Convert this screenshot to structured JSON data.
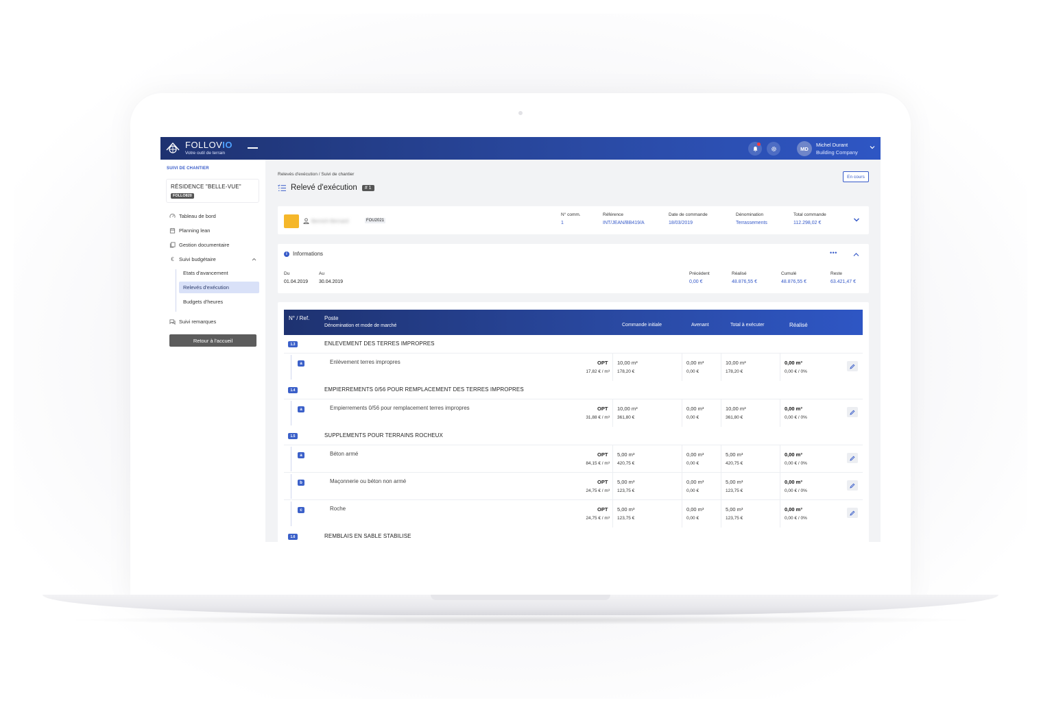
{
  "app": {
    "logo_text": "FOLLOV",
    "logo_text_accent": "IO",
    "logo_subtitle": "Votre outil de terrain",
    "user": {
      "initials": "MD",
      "name": "Michel Durant",
      "company": "Building Company"
    }
  },
  "sidebar": {
    "section_label": "SUIVI DE CHANTIER",
    "project": {
      "name": "RÉSIDENCE \"BELLE-VUE\"",
      "code": "FOLLO820"
    },
    "items": [
      {
        "label": "Tableau de bord",
        "icon": "dashboard-icon"
      },
      {
        "label": "Planning lean",
        "icon": "calendar-icon"
      },
      {
        "label": "Gestion documentaire",
        "icon": "documents-icon"
      },
      {
        "label": "Suivi budgétaire",
        "icon": "euro-icon"
      }
    ],
    "sub_items": [
      {
        "label": "Etats d'avancement"
      },
      {
        "label": "Relevés d'exécution",
        "active": true
      },
      {
        "label": "Budgets d'heures"
      }
    ],
    "remarks_label": "Suivi remarques",
    "home_button": "Retour à l'accueil"
  },
  "page": {
    "breadcrumb": "Relevés d'exécution  /  Suivi de chantier",
    "status": "En cours",
    "title": "Relevé d'exécution",
    "number": "# 1"
  },
  "order": {
    "swatch_color": "#f5b72a",
    "supplier_name": "Bernich Bernard",
    "supplier_code": "FOU2021",
    "fields": [
      {
        "label": "N° comm.",
        "value": "1"
      },
      {
        "label": "Référence",
        "value": "INT/JEAN/BB419/A"
      },
      {
        "label": "Date de commande",
        "value": "18/03/2019"
      },
      {
        "label": "Dénomination",
        "value": "Terrassements"
      },
      {
        "label": "Total commande",
        "value": "112.298,02 €"
      }
    ]
  },
  "info": {
    "title": "Informations",
    "more": "•••",
    "du_label": "Du",
    "du_value": "01.04.2019",
    "au_label": "Au",
    "au_value": "30.04.2019",
    "totals": [
      {
        "label": "Précédent",
        "value": "0,00 €"
      },
      {
        "label": "Réalisé",
        "value": "48.876,55 €"
      },
      {
        "label": "Cumulé",
        "value": "48.876,55 €"
      },
      {
        "label": "Reste",
        "value": "63.421,47 €"
      }
    ]
  },
  "table": {
    "headers": {
      "ref": "N° / Ref.",
      "poste": "Poste",
      "poste_sub": "Dénomination et mode de marché",
      "commande": "Commande initiale",
      "avenant": "Avenant",
      "total": "Total à exécuter",
      "realise": "Réalisé"
    },
    "sections": [
      {
        "ref": "1.3",
        "title": "ENLEVEMENT DES TERRES IMPROPRES"
      },
      {
        "ref": "1.4",
        "title": "EMPIERREMENTS 0/56 POUR REMPLACEMENT DES TERRES IMPROPRES"
      },
      {
        "ref": "1.5",
        "title": "SUPPLEMENTS POUR TERRAINS ROCHEUX"
      },
      {
        "ref": "1.6",
        "title": "REMBLAIS EN SABLE STABILISE"
      }
    ],
    "rows": [
      {
        "ref": "a",
        "name": "Enlèvement terres impropres",
        "mode": "OPT",
        "unit_price": "17,82 € / m³",
        "cmd_q": "10,00 m³",
        "cmd_m": "178,20 €",
        "av_q": "0,00 m³",
        "av_m": "0,00 €",
        "tot_q": "10,00 m³",
        "tot_m": "178,20 €",
        "real_q": "0,00 m³",
        "real_m": "0,00 € / 0%"
      },
      {
        "ref": "a",
        "name": "Empierrements 0/56 pour remplacement terres impropres",
        "mode": "OPT",
        "unit_price": "31,88 € / m³",
        "cmd_q": "10,00 m³",
        "cmd_m": "361,80 €",
        "av_q": "0,00 m³",
        "av_m": "0,00 €",
        "tot_q": "10,00 m³",
        "tot_m": "361,80 €",
        "real_q": "0,00 m³",
        "real_m": "0,00 € / 0%"
      },
      {
        "ref": "a",
        "name": "Béton armé",
        "mode": "OPT",
        "unit_price": "84,15 € / m³",
        "cmd_q": "5,00 m³",
        "cmd_m": "420,75 €",
        "av_q": "0,00 m³",
        "av_m": "0,00 €",
        "tot_q": "5,00 m³",
        "tot_m": "420,75 €",
        "real_q": "0,00 m³",
        "real_m": "0,00 € / 0%"
      },
      {
        "ref": "b",
        "name": "Maçonnerie ou béton non armé",
        "mode": "OPT",
        "unit_price": "24,75 € / m³",
        "cmd_q": "5,00 m³",
        "cmd_m": "123,75 €",
        "av_q": "0,00 m³",
        "av_m": "0,00 €",
        "tot_q": "5,00 m³",
        "tot_m": "123,75 €",
        "real_q": "0,00 m³",
        "real_m": "0,00 € / 0%"
      },
      {
        "ref": "c",
        "name": "Roche",
        "mode": "OPT",
        "unit_price": "24,75 € / m³",
        "cmd_q": "5,00 m³",
        "cmd_m": "123,75 €",
        "av_q": "0,00 m³",
        "av_m": "0,00 €",
        "tot_q": "5,00 m³",
        "tot_m": "123,75 €",
        "real_q": "0,00 m³",
        "real_m": "0,00 € / 0%"
      }
    ]
  }
}
